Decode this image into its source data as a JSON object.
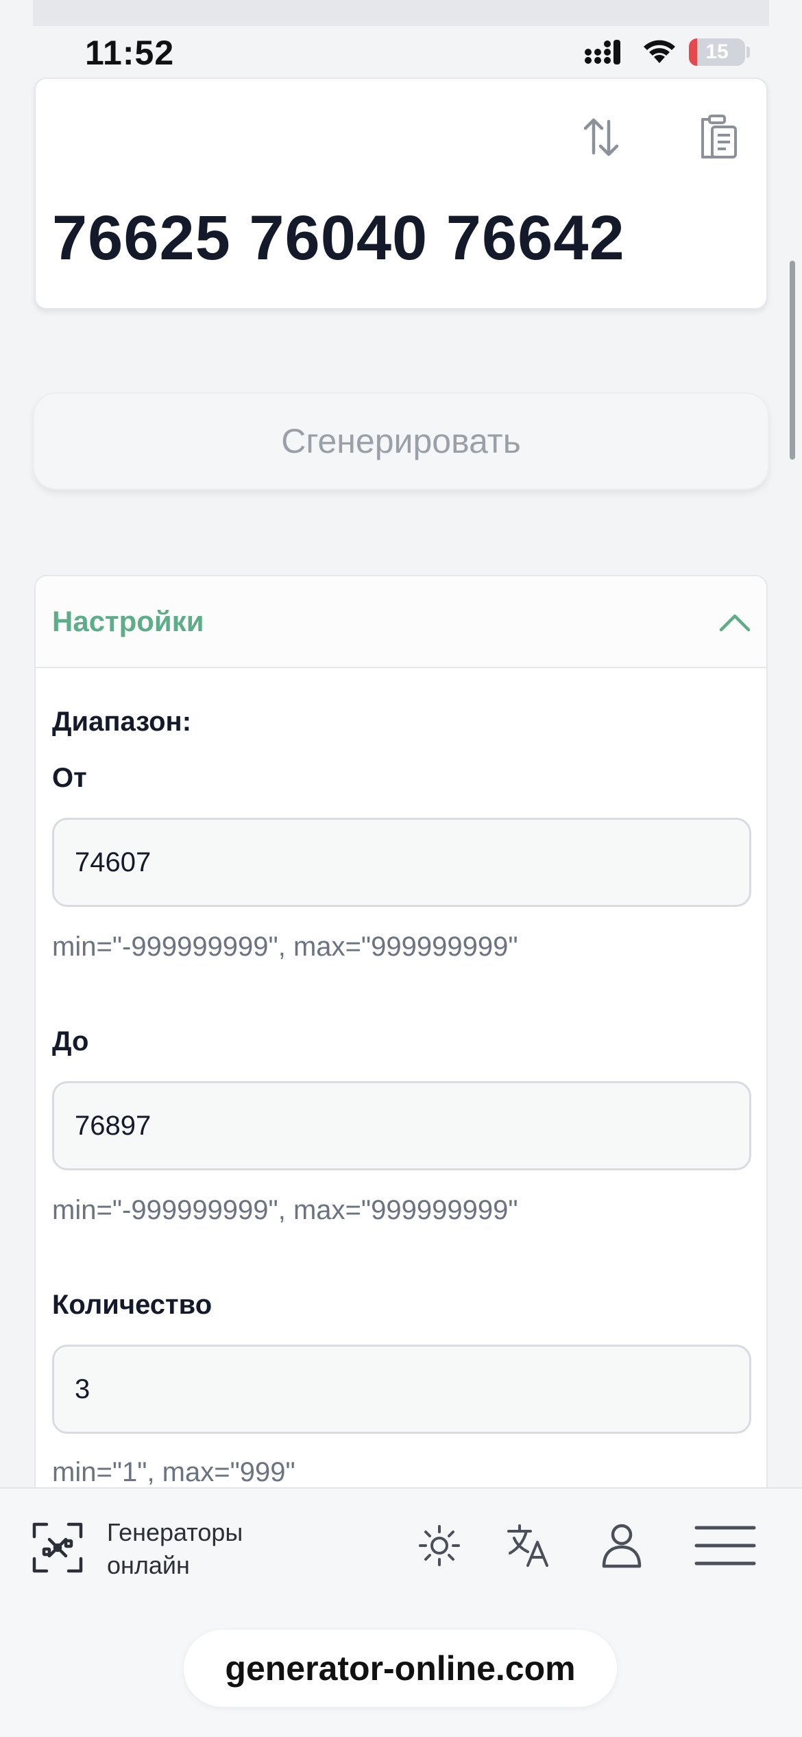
{
  "status_bar": {
    "time": "11:52",
    "battery": "15",
    "battery_fill_fraction": 0.15
  },
  "result": {
    "numbers": "76625 76040 76642",
    "sort_icon": "arrows-up-down-icon",
    "copy_icon": "clipboard-icon"
  },
  "actions": {
    "generate_label": "Сгенерировать"
  },
  "settings": {
    "title": "Настройки",
    "range_label": "Диапазон:",
    "from": {
      "label": "От",
      "value": "74607",
      "hint": "min=\"-999999999\", max=\"999999999\""
    },
    "to": {
      "label": "До",
      "value": "76897",
      "hint": "min=\"-999999999\", max=\"999999999\""
    },
    "count": {
      "label": "Количество",
      "value": "3",
      "hint": "min=\"1\", max=\"999\""
    }
  },
  "bottom_nav": {
    "brand_line1": "Генераторы",
    "brand_line2": "онлайн",
    "icons": [
      "sun-icon",
      "translate-icon",
      "user-icon",
      "hamburger-menu-icon"
    ]
  },
  "browser": {
    "url": "generator-online.com"
  },
  "colors": {
    "accent_green": "#5cad88",
    "background": "#f3f4f6",
    "text_dark": "#151a2b",
    "muted": "#9aa0a8"
  }
}
